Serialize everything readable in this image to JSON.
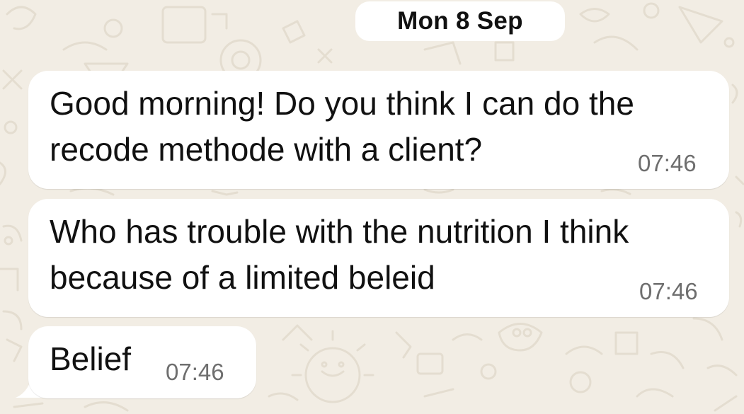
{
  "chat": {
    "date_header": "Mon 8 Sep",
    "messages": [
      {
        "lines": [
          "Good morning! Do you think I can do the",
          "recode methode with a client?"
        ],
        "time": "07:46"
      },
      {
        "lines": [
          "Who has trouble with the nutrition I think",
          "because of a limited beleid"
        ],
        "time": "07:46"
      },
      {
        "lines": [
          "Belief"
        ],
        "time": "07:46"
      }
    ]
  },
  "theme": {
    "wallpaper_color": "#F2EDE4",
    "bubble_color": "#FFFFFF",
    "text_color": "#111111",
    "time_color": "#6E6E6E"
  }
}
